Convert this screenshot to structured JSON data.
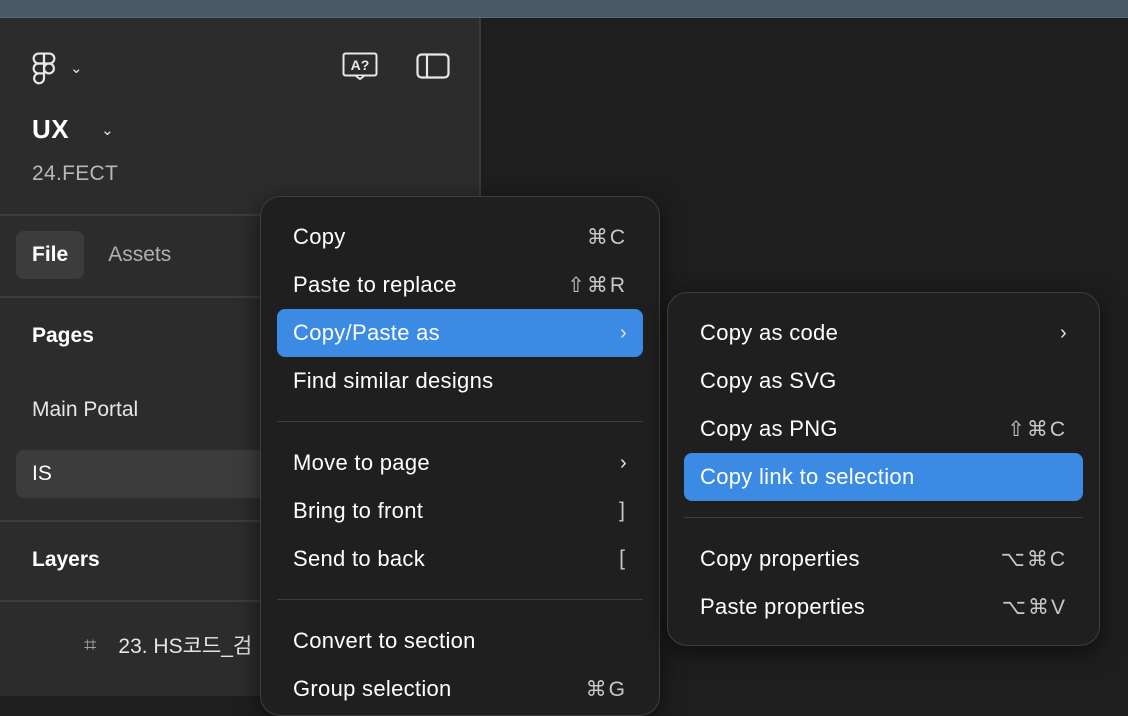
{
  "file": {
    "name": "UX",
    "subtitle": "24.FECT"
  },
  "tabs": [
    {
      "label": "File"
    },
    {
      "label": "Assets"
    }
  ],
  "pages": {
    "heading": "Pages",
    "items": [
      {
        "label": "Main Portal"
      },
      {
        "label": "IS"
      }
    ]
  },
  "layers": {
    "heading": "Layers",
    "items": [
      {
        "label": "23. HS코드_검"
      }
    ]
  },
  "context_menu": {
    "items": [
      {
        "label": "Copy",
        "shortcut": "⌘C"
      },
      {
        "label": "Paste to replace",
        "shortcut": "⇧⌘R"
      },
      {
        "label": "Copy/Paste as",
        "shortcut": "›"
      },
      {
        "label": "Find similar designs",
        "shortcut": ""
      },
      {
        "label": "Move to page",
        "shortcut": "›"
      },
      {
        "label": "Bring to front",
        "shortcut": "]"
      },
      {
        "label": "Send to back",
        "shortcut": "["
      },
      {
        "label": "Convert to section",
        "shortcut": ""
      },
      {
        "label": "Group selection",
        "shortcut": "⌘G"
      }
    ]
  },
  "submenu": {
    "items": [
      {
        "label": "Copy as code",
        "shortcut": "›"
      },
      {
        "label": "Copy as SVG",
        "shortcut": ""
      },
      {
        "label": "Copy as PNG",
        "shortcut": "⇧⌘C"
      },
      {
        "label": "Copy link to selection",
        "shortcut": ""
      },
      {
        "label": "Copy properties",
        "shortcut": "⌥⌘C"
      },
      {
        "label": "Paste properties",
        "shortcut": "⌥⌘V"
      }
    ]
  },
  "colors": {
    "highlight": "#3b8ae3",
    "sidebar_bg": "#2c2c2c",
    "menu_bg": "#1f1f1f",
    "canvas_bg": "#1e1e1e"
  },
  "icons": {
    "logo": "figma-logo-icon",
    "translate": "translate-icon",
    "panel": "sidebar-toggle-icon"
  }
}
